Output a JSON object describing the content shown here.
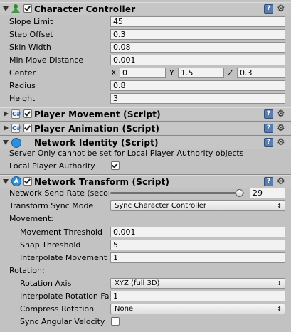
{
  "character_controller": {
    "title": "Character Controller",
    "enabled": true,
    "fields": {
      "slope_limit": {
        "label": "Slope Limit",
        "value": "45"
      },
      "step_offset": {
        "label": "Step Offset",
        "value": "0.3"
      },
      "skin_width": {
        "label": "Skin Width",
        "value": "0.08"
      },
      "min_move_distance": {
        "label": "Min Move Distance",
        "value": "0.001"
      },
      "center": {
        "label": "Center",
        "x_label": "X",
        "x": "0",
        "y_label": "Y",
        "y": "1.5",
        "z_label": "Z",
        "z": "0.3"
      },
      "radius": {
        "label": "Radius",
        "value": "0.8"
      },
      "height": {
        "label": "Height",
        "value": "3"
      }
    }
  },
  "player_movement": {
    "title": "Player Movement (Script)",
    "enabled": true
  },
  "player_animation": {
    "title": "Player Animation (Script)",
    "enabled": true
  },
  "network_identity": {
    "title": "Network Identity (Script)",
    "message": "Server Only cannot be set for Local Player Authority objects",
    "local_player_authority": {
      "label": "Local Player Authority",
      "checked": true
    }
  },
  "network_transform": {
    "title": "Network Transform (Script)",
    "enabled": true,
    "send_rate": {
      "label": "Network Send Rate (seconds)",
      "value": "29",
      "fraction": 0.97
    },
    "sync_mode": {
      "label": "Transform Sync Mode",
      "value": "Sync Character Controller"
    },
    "movement_header": "Movement:",
    "movement_threshold": {
      "label": "Movement Threshold",
      "value": "0.001"
    },
    "snap_threshold": {
      "label": "Snap Threshold",
      "value": "5"
    },
    "interpolate_movement": {
      "label": "Interpolate Movement",
      "value": "1"
    },
    "rotation_header": "Rotation:",
    "rotation_axis": {
      "label": "Rotation Axis",
      "value": "XYZ (full 3D)"
    },
    "interpolate_rotation": {
      "label": "Interpolate Rotation Factor",
      "value": "1"
    },
    "compress_rotation": {
      "label": "Compress Rotation",
      "value": "None"
    },
    "sync_angular_velocity": {
      "label": "Sync Angular Velocity",
      "checked": false
    }
  },
  "icons": {
    "help": "help-icon",
    "settings": "gear-icon",
    "dropdown_arrow": "↕"
  },
  "colors": {
    "panel_bg": "#c2c2c2",
    "identity_icon": "#2f8fd8"
  }
}
